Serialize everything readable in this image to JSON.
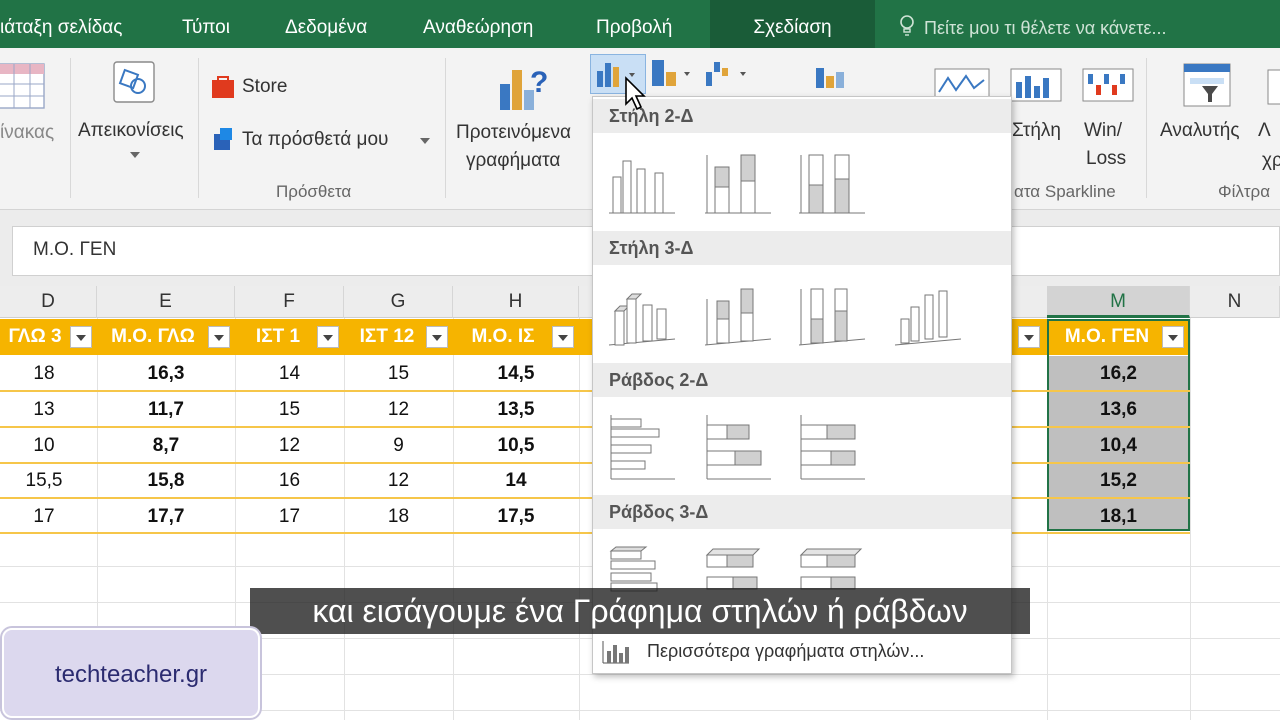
{
  "menubar": {
    "tabs": [
      "ιάταξη σελίδας",
      "Τύποι",
      "Δεδομένα",
      "Αναθεώρηση",
      "Προβολή",
      "Σχεδίαση"
    ],
    "tellme": "Πείτε μου τι θέλετε να κάνετε..."
  },
  "ribbon": {
    "table_label": "ίνακας",
    "illustrations_label": "Απεικονίσεις",
    "store_label": "Store",
    "addins_label": "Τα πρόσθετά μου",
    "addins_group": "Πρόσθετα",
    "recommended_line1": "Προτεινόμενα",
    "recommended_line2": "γραφήματα",
    "sparkline_column": "Στήλη",
    "sparkline_winloss_line1": "Win/",
    "sparkline_winloss_line2": "Loss",
    "sparkline_group": "ατα Sparkline",
    "slicer_label": "Αναλυτής",
    "timeline_label_line1": "Λ",
    "timeline_label_line2": "χρ",
    "filters_group": "Φίλτρα"
  },
  "formula": {
    "value": "Μ.Ο. ΓΕΝ"
  },
  "grid": {
    "columns": [
      "D",
      "E",
      "F",
      "G",
      "H",
      "M",
      "N"
    ],
    "headers": [
      "ΓΛΩ 3",
      "Μ.Ο. ΓΛΩ",
      "ΙΣΤ 1",
      "ΙΣΤ 12",
      "Μ.Ο. ΙΣ",
      "Μ.Ο. ΓΕΝ"
    ],
    "rows": [
      [
        "18",
        "16,3",
        "14",
        "15",
        "14,5",
        "16,2"
      ],
      [
        "13",
        "11,7",
        "15",
        "12",
        "13,5",
        "13,6"
      ],
      [
        "10",
        "8,7",
        "12",
        "9",
        "10,5",
        "10,4"
      ],
      [
        "15,5",
        "15,8",
        "16",
        "12",
        "14",
        "15,2"
      ],
      [
        "17",
        "17,7",
        "17",
        "18",
        "17,5",
        "18,1"
      ]
    ]
  },
  "dropdown": {
    "section_col2d": "Στήλη 2-Δ",
    "section_col3d": "Στήλη 3-Δ",
    "section_bar2d": "Ράβδος 2-Δ",
    "section_bar3d": "Ράβδος 3-Δ",
    "more": "Περισσότερα γραφήματα στηλών..."
  },
  "caption": "και εισάγουμε ένα Γράφημα στηλών ή ράβδων",
  "watermark": "techteacher.gr",
  "colors": {
    "excel_green": "#217346",
    "header_fill": "#f6b400",
    "selection_fill": "#bfbfbf"
  }
}
